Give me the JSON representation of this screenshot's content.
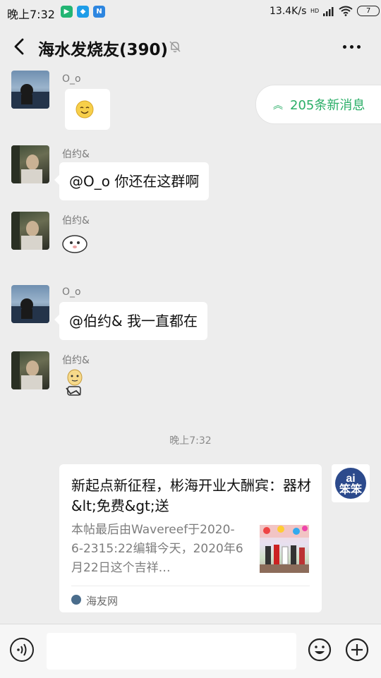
{
  "status_bar": {
    "time": "晚上7:32",
    "app_icons": [
      "iqiyi-icon",
      "weixin-icon",
      "n-app-icon"
    ],
    "network_speed": "13.4K/s",
    "signal_label": "HD",
    "battery": "7"
  },
  "header": {
    "title": "海水发烧友(390)",
    "muted": true
  },
  "new_messages": {
    "label": "205条新消息",
    "color": "#2aae67"
  },
  "messages": [
    {
      "sender": "O_o",
      "type": "sticker",
      "sticker": "smiling-emoji-icon",
      "avatar": "blue"
    },
    {
      "sender": "伯约&",
      "type": "text",
      "text": "@O_o  你还在这群啊",
      "avatar": "dark"
    },
    {
      "sender": "伯约&",
      "type": "sticker",
      "sticker": "face-sticker-icon",
      "avatar": "dark"
    },
    {
      "sender": "O_o",
      "type": "text",
      "text": "@伯约&  我一直都在",
      "avatar": "blue"
    },
    {
      "sender": "伯约&",
      "type": "sticker",
      "sticker": "thinking-sticker-icon",
      "avatar": "dark"
    }
  ],
  "time_divider": "晚上7:32",
  "link_card": {
    "title": "新起点新征程，彬海开业大酬宾：器材&lt;免费&gt;送",
    "description": "本帖最后由Wavereef于2020-6-2315:22编辑今天，2020年6月22日这个吉祥…",
    "source": "海友网"
  },
  "self_avatar_label": "ai 笨笨",
  "input_bar": {
    "placeholder": ""
  }
}
